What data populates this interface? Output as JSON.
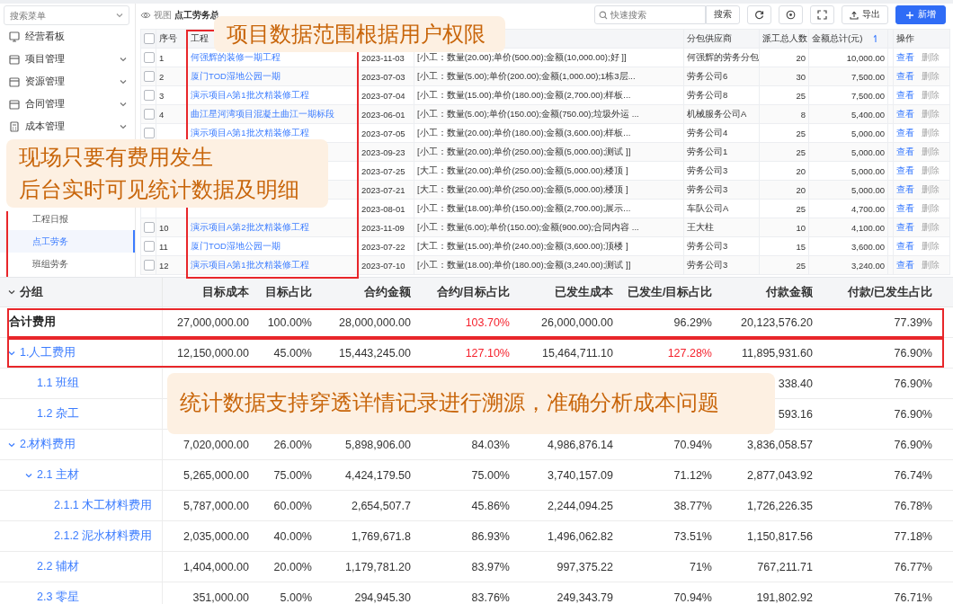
{
  "sidebar": {
    "search_placeholder": "搜索菜单",
    "items": [
      {
        "label": "经营看板",
        "expandable": false
      },
      {
        "label": "项目管理",
        "expandable": true
      },
      {
        "label": "资源管理",
        "expandable": true
      },
      {
        "label": "合同管理",
        "expandable": true
      },
      {
        "label": "成本管理",
        "expandable": true
      }
    ],
    "sub_items": [
      {
        "label": "工程日报",
        "selected": false
      },
      {
        "label": "点工劳务",
        "selected": true
      },
      {
        "label": "班组劳务",
        "selected": false
      }
    ]
  },
  "toolbar": {
    "view_label": "视图",
    "view_name": "点工劳务总",
    "search_placeholder": "快速搜索",
    "search_button": "搜索",
    "export_button": "导出",
    "add_button": "新增"
  },
  "labor_table": {
    "all_checked": false,
    "headers": {
      "seq": "序号",
      "project": "工程",
      "supplier": "分包供应商",
      "workers": "派工总人数",
      "amount": "金额总计(元)",
      "actions": "操作"
    },
    "rows": [
      {
        "checked": false,
        "seq": "1",
        "project": "何强辉的装修一期工程",
        "date": "2023-11-03",
        "detail": "[小工：数量(20.00);单价(500.00);金额(10,000.00);好 ]]",
        "supplier": "何强辉的劳务分包",
        "workers": "20",
        "amount": "10,000.00",
        "actions": [
          {
            "label": "查看",
            "disabled": false
          },
          {
            "label": "删除",
            "disabled": true
          }
        ]
      },
      {
        "checked": false,
        "seq": "2",
        "project": "厦门TOD湿地公园一期",
        "date": "2023-07-03",
        "detail": "[小工：数量(5.00);单价(200.00);金额(1,000.00);1栋3层...",
        "supplier": "劳务公司6",
        "workers": "30",
        "amount": "7,500.00",
        "actions": [
          {
            "label": "查看",
            "disabled": false
          },
          {
            "label": "删除",
            "disabled": true
          }
        ]
      },
      {
        "checked": false,
        "seq": "3",
        "project": "演示项目A第1批次精装修工程",
        "date": "2023-07-04",
        "detail": "[小工：数量(15.00);单价(180.00);金额(2,700.00);样板...",
        "supplier": "劳务公司8",
        "workers": "25",
        "amount": "7,500.00",
        "actions": [
          {
            "label": "查看",
            "disabled": false
          },
          {
            "label": "删除",
            "disabled": true
          }
        ]
      },
      {
        "checked": false,
        "seq": "4",
        "project": "曲江星河湾项目混凝土曲江一期标段",
        "date": "2023-06-01",
        "detail": "[小工：数量(5.00);单价(150.00);金额(750.00);垃圾外运 ...",
        "supplier": "机械服务公司A",
        "workers": "8",
        "amount": "5,400.00",
        "actions": [
          {
            "label": "查看",
            "disabled": false
          },
          {
            "label": "删除",
            "disabled": true
          }
        ]
      },
      {
        "checked": false,
        "project": "演示项目A第1批次精装修工程",
        "date": "2023-07-05",
        "detail": "[小工：数量(20.00);单价(180.00);金额(3,600.00);样板...",
        "supplier": "劳务公司4",
        "workers": "25",
        "amount": "5,000.00",
        "actions": [
          {
            "label": "查看",
            "disabled": false
          },
          {
            "label": "删除",
            "disabled": true
          }
        ]
      },
      {
        "date": "2023-09-23",
        "detail": "[小工：数量(20.00);单价(250.00);金额(5,000.00);测试 ]]",
        "supplier": "劳务公司1",
        "workers": "25",
        "amount": "5,000.00",
        "actions": [
          {
            "label": "查看",
            "disabled": false
          },
          {
            "label": "删除",
            "disabled": true
          }
        ]
      },
      {
        "date": "2023-07-25",
        "detail": "[大工：数量(20.00);单价(250.00);金额(5,000.00);楼顶 ]",
        "supplier": "劳务公司3",
        "workers": "20",
        "amount": "5,000.00",
        "actions": [
          {
            "label": "查看",
            "disabled": false
          },
          {
            "label": "删除",
            "disabled": true
          }
        ]
      },
      {
        "date": "2023-07-21",
        "detail": "[大工：数量(20.00);单价(250.00);金额(5,000.00);楼顶 ]",
        "supplier": "劳务公司3",
        "workers": "20",
        "amount": "5,000.00",
        "actions": [
          {
            "label": "查看",
            "disabled": false
          },
          {
            "label": "删除",
            "disabled": true
          }
        ]
      },
      {
        "date": "2023-08-01",
        "detail": "[小工：数量(18.00);单价(150.00);金额(2,700.00);展示...",
        "supplier": "车队公司A",
        "workers": "25",
        "amount": "4,700.00",
        "actions": [
          {
            "label": "查看",
            "disabled": false
          },
          {
            "label": "删除",
            "disabled": true
          }
        ]
      },
      {
        "checked": false,
        "seq": "10",
        "project": "演示项目A第2批次精装修工程",
        "date": "2023-11-09",
        "detail": "[小工：数量(6.00);单价(150.00);金额(900.00);合同内容 ...",
        "supplier": "王大柱",
        "workers": "10",
        "amount": "4,100.00",
        "actions": [
          {
            "label": "查看",
            "disabled": false
          },
          {
            "label": "删除",
            "disabled": true
          }
        ]
      },
      {
        "checked": false,
        "seq": "11",
        "project": "厦门TOD湿地公园一期",
        "date": "2023-07-22",
        "detail": "[大工：数量(15.00);单价(240.00);金额(3,600.00);顶楼 ]",
        "supplier": "劳务公司3",
        "workers": "15",
        "amount": "3,600.00",
        "actions": [
          {
            "label": "查看",
            "disabled": false
          },
          {
            "label": "删除",
            "disabled": true
          }
        ]
      },
      {
        "checked": false,
        "seq": "12",
        "project": "演示项目A第1批次精装修工程",
        "date": "2023-07-10",
        "detail": "[小工：数量(18.00);单价(180.00);金额(3,240.00);测试 ]]",
        "supplier": "劳务公司3",
        "workers": "25",
        "amount": "3,240.00",
        "actions": [
          {
            "label": "查看",
            "disabled": false
          },
          {
            "label": "删除",
            "disabled": true
          }
        ]
      }
    ]
  },
  "cost_table": {
    "all_expanded": true,
    "headers": [
      "分组",
      "目标成本",
      "目标占比",
      "合约金额",
      "合约/目标占比",
      "已发生成本",
      "已发生/目标占比",
      "付款金额",
      "付款/已发生占比"
    ],
    "rows": [
      {
        "kind": "total",
        "name": "合计费用",
        "target_cost": "27,000,000.00",
        "target_ratio": "100.00%",
        "contract_amount": "28,000,000.00",
        "contract_ratio": "103.70%",
        "contract_ratio_alert": true,
        "incurred_cost": "26,000,000.00",
        "incurred_ratio": "96.29%",
        "incurred_ratio_alert": false,
        "payment": "20,123,576.20",
        "payment_ratio": "77.39%"
      },
      {
        "kind": "group",
        "expanded": true,
        "name": "1.人工费用",
        "target_cost": "12,150,000.00",
        "target_ratio": "45.00%",
        "contract_amount": "15,443,245.00",
        "contract_ratio": "127.10%",
        "contract_ratio_alert": true,
        "incurred_cost": "15,464,711.10",
        "incurred_ratio": "127.28%",
        "incurred_ratio_alert": true,
        "payment": "11,895,931.60",
        "payment_ratio": "76.90%",
        "children": [
          {
            "kind": "item",
            "name": "1.1 班组",
            "payment": "338.40",
            "payment_ratio": "76.90%"
          },
          {
            "kind": "item",
            "name": "1.2 杂工",
            "payment": "593.16",
            "payment_ratio": "76.90%"
          }
        ]
      },
      {
        "kind": "group",
        "expanded": true,
        "name": "2.材料费用",
        "target_cost": "7,020,000.00",
        "target_ratio": "26.00%",
        "contract_amount": "5,898,906.00",
        "contract_ratio": "84.03%",
        "contract_ratio_alert": false,
        "incurred_cost": "4,986,876.14",
        "incurred_ratio": "70.94%",
        "incurred_ratio_alert": false,
        "payment": "3,836,058.57",
        "payment_ratio": "76.90%",
        "children": [
          {
            "kind": "group",
            "expanded": true,
            "name": "2.1 主材",
            "target_cost": "5,265,000.00",
            "target_ratio": "75.00%",
            "contract_amount": "4,424,179.50",
            "contract_ratio": "75.00%",
            "contract_ratio_alert": false,
            "incurred_cost": "3,740,157.09",
            "incurred_ratio": "71.12%",
            "incurred_ratio_alert": false,
            "payment": "2,877,043.92",
            "payment_ratio": "76.74%",
            "children": [
              {
                "kind": "item",
                "name": "2.1.1 木工材料费用",
                "target_cost": "5,787,000.00",
                "target_ratio": "60.00%",
                "contract_amount": "2,654,507.7",
                "contract_ratio": "45.86%",
                "contract_ratio_alert": false,
                "incurred_cost": "2,244,094.25",
                "incurred_ratio": "38.77%",
                "incurred_ratio_alert": false,
                "payment": "1,726,226.35",
                "payment_ratio": "76.78%"
              },
              {
                "kind": "item",
                "name": "2.1.2 泥水材料费用",
                "target_cost": "2,035,000.00",
                "target_ratio": "40.00%",
                "contract_amount": "1,769,671.8",
                "contract_ratio": "86.93%",
                "contract_ratio_alert": false,
                "incurred_cost": "1,496,062.82",
                "incurred_ratio": "73.51%",
                "incurred_ratio_alert": false,
                "payment": "1,150,817.56",
                "payment_ratio": "77.18%"
              }
            ]
          },
          {
            "kind": "item",
            "name": "2.2 辅材",
            "target_cost": "1,404,000.00",
            "target_ratio": "20.00%",
            "contract_amount": "1,179,781.20",
            "contract_ratio": "83.97%",
            "contract_ratio_alert": false,
            "incurred_cost": "997,375.22",
            "incurred_ratio": "71%",
            "incurred_ratio_alert": false,
            "payment": "767,211.71",
            "payment_ratio": "76.77%"
          },
          {
            "kind": "item",
            "name": "2.3 零星",
            "target_cost": "351,000.00",
            "target_ratio": "5.00%",
            "contract_amount": "294,945.30",
            "contract_ratio": "83.76%",
            "contract_ratio_alert": false,
            "incurred_cost": "249,343.79",
            "incurred_ratio": "70.94%",
            "incurred_ratio_alert": false,
            "payment": "191,802.92",
            "payment_ratio": "76.71%"
          }
        ]
      }
    ]
  },
  "callouts": [
    {
      "lines": [
        "项目数据范围根据用户权限"
      ]
    },
    {
      "lines": [
        "现场只要有费用发生",
        "后台实时可见统计数据及明细"
      ]
    },
    {
      "lines": [
        "统计数据支持穿透详情记录进行溯源，准确分析成本问题"
      ]
    }
  ]
}
